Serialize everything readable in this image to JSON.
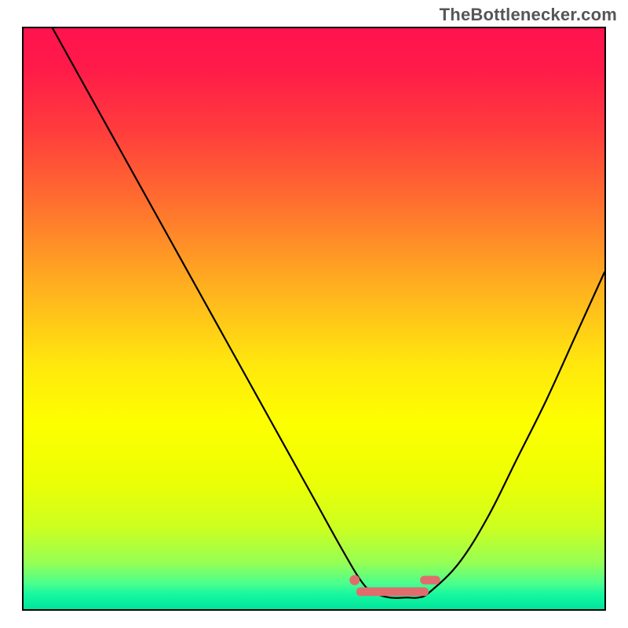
{
  "attribution": "TheBottlenecker.com",
  "colors": {
    "frame": "#000000",
    "curve": "#000000",
    "marker": "#e06d6d",
    "gradient_stops": [
      {
        "offset": 0.0,
        "color": "#ff134e"
      },
      {
        "offset": 0.07,
        "color": "#ff1b49"
      },
      {
        "offset": 0.18,
        "color": "#ff3e3c"
      },
      {
        "offset": 0.3,
        "color": "#ff6f2f"
      },
      {
        "offset": 0.45,
        "color": "#ffb21f"
      },
      {
        "offset": 0.58,
        "color": "#ffe80d"
      },
      {
        "offset": 0.68,
        "color": "#fdff00"
      },
      {
        "offset": 0.78,
        "color": "#ecff05"
      },
      {
        "offset": 0.86,
        "color": "#ccff20"
      },
      {
        "offset": 0.92,
        "color": "#96ff54"
      },
      {
        "offset": 0.955,
        "color": "#4dff8c"
      },
      {
        "offset": 0.975,
        "color": "#15f8a0"
      },
      {
        "offset": 1.0,
        "color": "#00e59c"
      }
    ]
  },
  "chart_data": {
    "type": "line",
    "title": "",
    "xlabel": "",
    "ylabel": "",
    "xlim": [
      0,
      100
    ],
    "ylim": [
      0,
      100
    ],
    "grid": false,
    "legend": false,
    "series": [
      {
        "name": "bottleneck-curve",
        "x": [
          5,
          10,
          15,
          20,
          25,
          30,
          35,
          40,
          45,
          50,
          55,
          58,
          60,
          63,
          66,
          68,
          70,
          75,
          80,
          85,
          90,
          95,
          100
        ],
        "y": [
          100,
          91,
          82,
          73,
          64,
          55,
          46,
          37,
          28,
          19,
          10,
          5,
          3,
          2,
          2,
          2,
          3,
          8,
          16,
          26,
          36,
          47,
          58
        ]
      }
    ],
    "markers": [
      {
        "name": "optimal-range-left-dot",
        "x": 57,
        "y": 5
      },
      {
        "name": "optimal-range-band",
        "x_from": 58,
        "x_to": 69,
        "y": 3
      },
      {
        "name": "optimal-range-right",
        "x_from": 69,
        "x_to": 71,
        "y": 5
      }
    ],
    "note": "Values are visual estimates; the source image has no numeric axis labels."
  }
}
